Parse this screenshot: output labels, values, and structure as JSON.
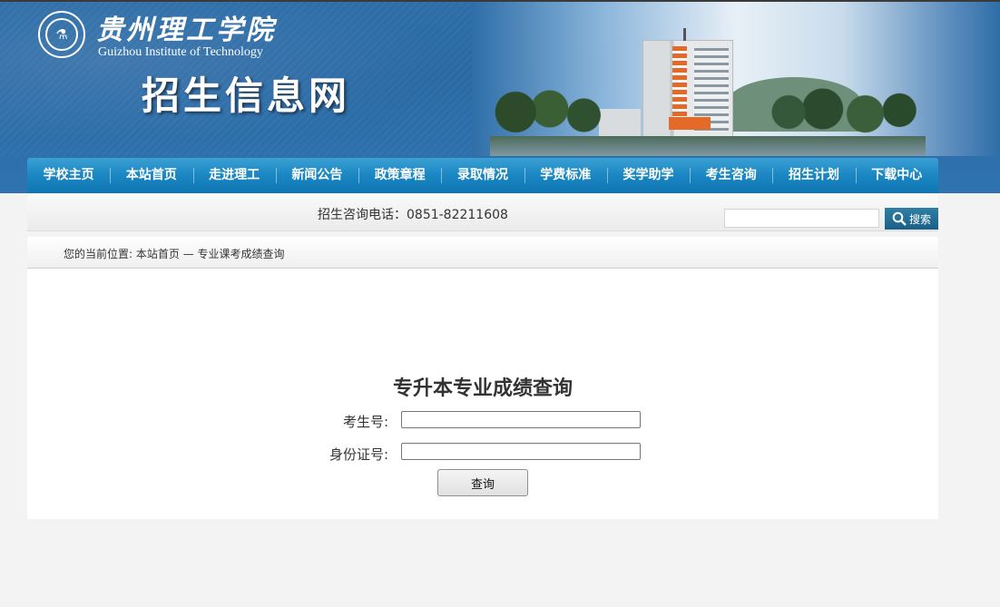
{
  "header": {
    "school_name_cn": "贵州理工学院",
    "school_name_en": "Guizhou Institute of Technology",
    "site_title": "招生信息网"
  },
  "nav": {
    "items": [
      {
        "label": "学校主页"
      },
      {
        "label": "本站首页"
      },
      {
        "label": "走进理工"
      },
      {
        "label": "新闻公告"
      },
      {
        "label": "政策章程"
      },
      {
        "label": "录取情况"
      },
      {
        "label": "学费标准"
      },
      {
        "label": "奖学助学"
      },
      {
        "label": "考生咨询"
      },
      {
        "label": "招生计划"
      },
      {
        "label": "下载中心"
      }
    ]
  },
  "contact": {
    "phone_text": "招生咨询电话：0851-82211608"
  },
  "search": {
    "value": "",
    "button_label": "搜索"
  },
  "breadcrumb": {
    "prefix": "您的当前位置: ",
    "home": "本站首页",
    "separator": " — ",
    "current": "专业课考成绩查询"
  },
  "form": {
    "title": "专升本专业成绩查询",
    "exam_no_label": "考生号:",
    "exam_no_value": "",
    "id_no_label": "身份证号:",
    "id_no_value": "",
    "submit_label": "查询"
  },
  "colors": {
    "nav_blue": "#1a86c2",
    "search_button": "#1a6089",
    "page_background": "#f3f3f3"
  }
}
